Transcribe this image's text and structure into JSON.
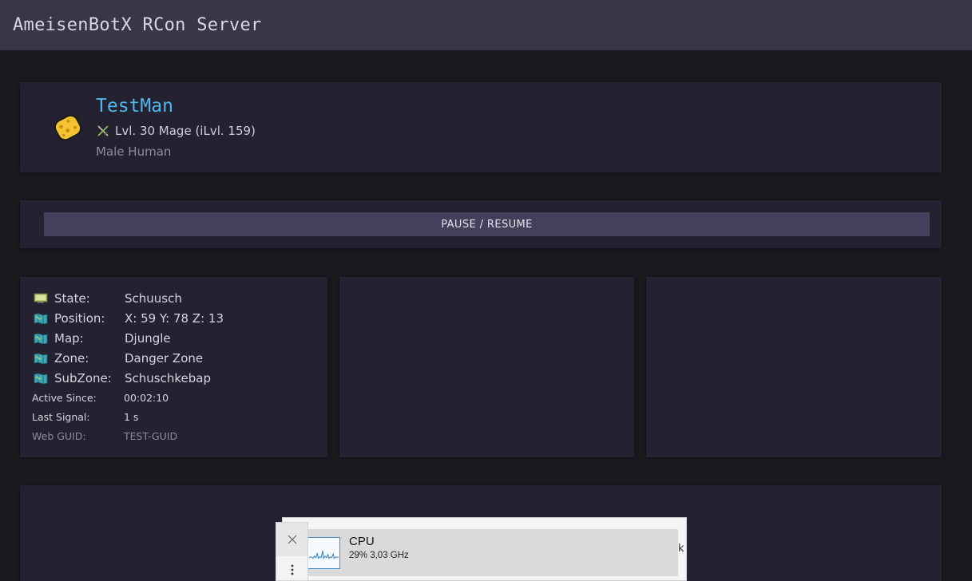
{
  "app": {
    "title": "AmeisenBotX RCon Server"
  },
  "character": {
    "name": "TestMan",
    "class_icon": "crossed-swords-icon",
    "level_line": "Lvl. 30 Mage (iLvl. 159)",
    "race_line": "Male Human"
  },
  "controls": {
    "pause_label": "PAUSE / RESUME"
  },
  "info": {
    "rows": [
      {
        "icon": "monitor-icon",
        "label": "State:",
        "value": "Schuusch"
      },
      {
        "icon": "map-icon",
        "label": "Position:",
        "value": "X: 59 Y: 78 Z: 13"
      },
      {
        "icon": "map-icon",
        "label": "Map:",
        "value": "Djungle"
      },
      {
        "icon": "map-icon",
        "label": "Zone:",
        "value": "Danger Zone"
      },
      {
        "icon": "map-icon",
        "label": "SubZone:",
        "value": "Schuschkebap"
      }
    ],
    "small_rows": [
      {
        "label": "Active Since:",
        "value": "00:02:10"
      },
      {
        "label": "Last Signal:",
        "value": "1 s"
      },
      {
        "label": "Web GUID:",
        "value": "TEST-GUID"
      }
    ]
  },
  "overlay": {
    "cpu_title": "CPU",
    "cpu_detail": "29%  3,03 GHz",
    "edge_glyph": "k",
    "close_icon": "close-icon",
    "more_icon": "more-vertical-icon"
  },
  "colors": {
    "accent_name": "#4fb7ea",
    "topbar": "#393646",
    "card": "#242131",
    "button": "#443f5a"
  }
}
